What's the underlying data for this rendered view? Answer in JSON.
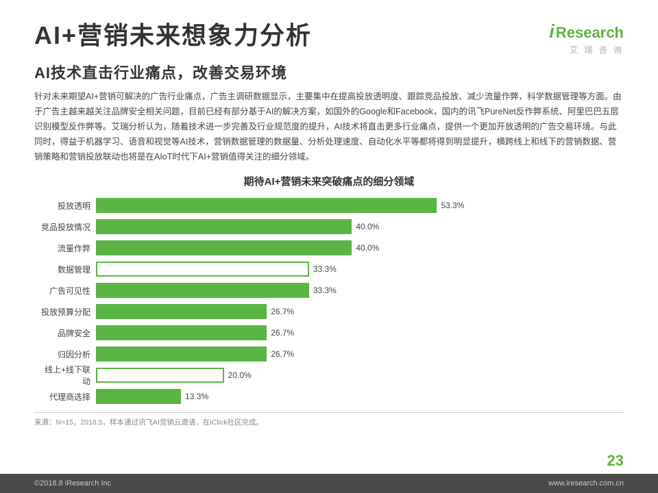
{
  "header": {
    "main_title": "AI+营销未来想象力分析",
    "sub_title": "AI技术直击行业痛点，改善交易环境",
    "logo_i": "i",
    "logo_research": "Research",
    "logo_chinese": "艾 瑞 咨 询"
  },
  "body_text": "针对未来期望AI+营销可解决的广告行业痛点，广告主调研数据显示，主要集中在提高投放透明度、跟踪竞品投放、减少流量作弊，科学数据管理等方面。由于广告主越来越关注品牌安全相关问题，目前已经有部分基于AI的解决方案，如国外的Google和Facebook，国内的讯飞PureNet反作弊系统、阿里巴巴五层识别模型反作弊等。艾瑞分析认为，随着技术进一步完善及行业规范度的提升，AI技术将直击更多行业痛点，提供一个更加开放透明的广告交易环境。与此同时，得益于机器学习、语音和视觉等AI技术，营销数据管理的数据量、分析处理速度、自动化水平等都将得到明显提升，横跨线上和线下的营销数据、营销策略和营销投放联动也将是在AIoT时代下AI+营销值得关注的细分领域。",
  "chart": {
    "title": "期待AI+营销未来突破痛点的细分领域",
    "bars": [
      {
        "label": "投放透明",
        "value": 53.3,
        "display": "53.3%",
        "outlined": false
      },
      {
        "label": "竞品投放情况",
        "value": 40.0,
        "display": "40.0%",
        "outlined": false
      },
      {
        "label": "流量作弊",
        "value": 40.0,
        "display": "40.0%",
        "outlined": false
      },
      {
        "label": "数据管理",
        "value": 33.3,
        "display": "33.3%",
        "outlined": true
      },
      {
        "label": "广告可见性",
        "value": 33.3,
        "display": "33.3%",
        "outlined": false
      },
      {
        "label": "投放预算分配",
        "value": 26.7,
        "display": "26.7%",
        "outlined": false
      },
      {
        "label": "品牌安全",
        "value": 26.7,
        "display": "26.7%",
        "outlined": false
      },
      {
        "label": "归因分析",
        "value": 26.7,
        "display": "26.7%",
        "outlined": false
      },
      {
        "label": "线上+线下联动",
        "value": 20.0,
        "display": "20.0%",
        "outlined": true
      },
      {
        "label": "代理商选择",
        "value": 13.3,
        "display": "13.3%",
        "outlined": false
      }
    ],
    "max_value": 60
  },
  "footer": {
    "source": "来源：N=15，2018.5，样本通过讯飞AI营销云邀请，在iClick社区完成。"
  },
  "bottom_bar": {
    "left": "©2018.8 iResearch Inc",
    "right": "www.iresearch.com.cn"
  },
  "page_number": "23"
}
